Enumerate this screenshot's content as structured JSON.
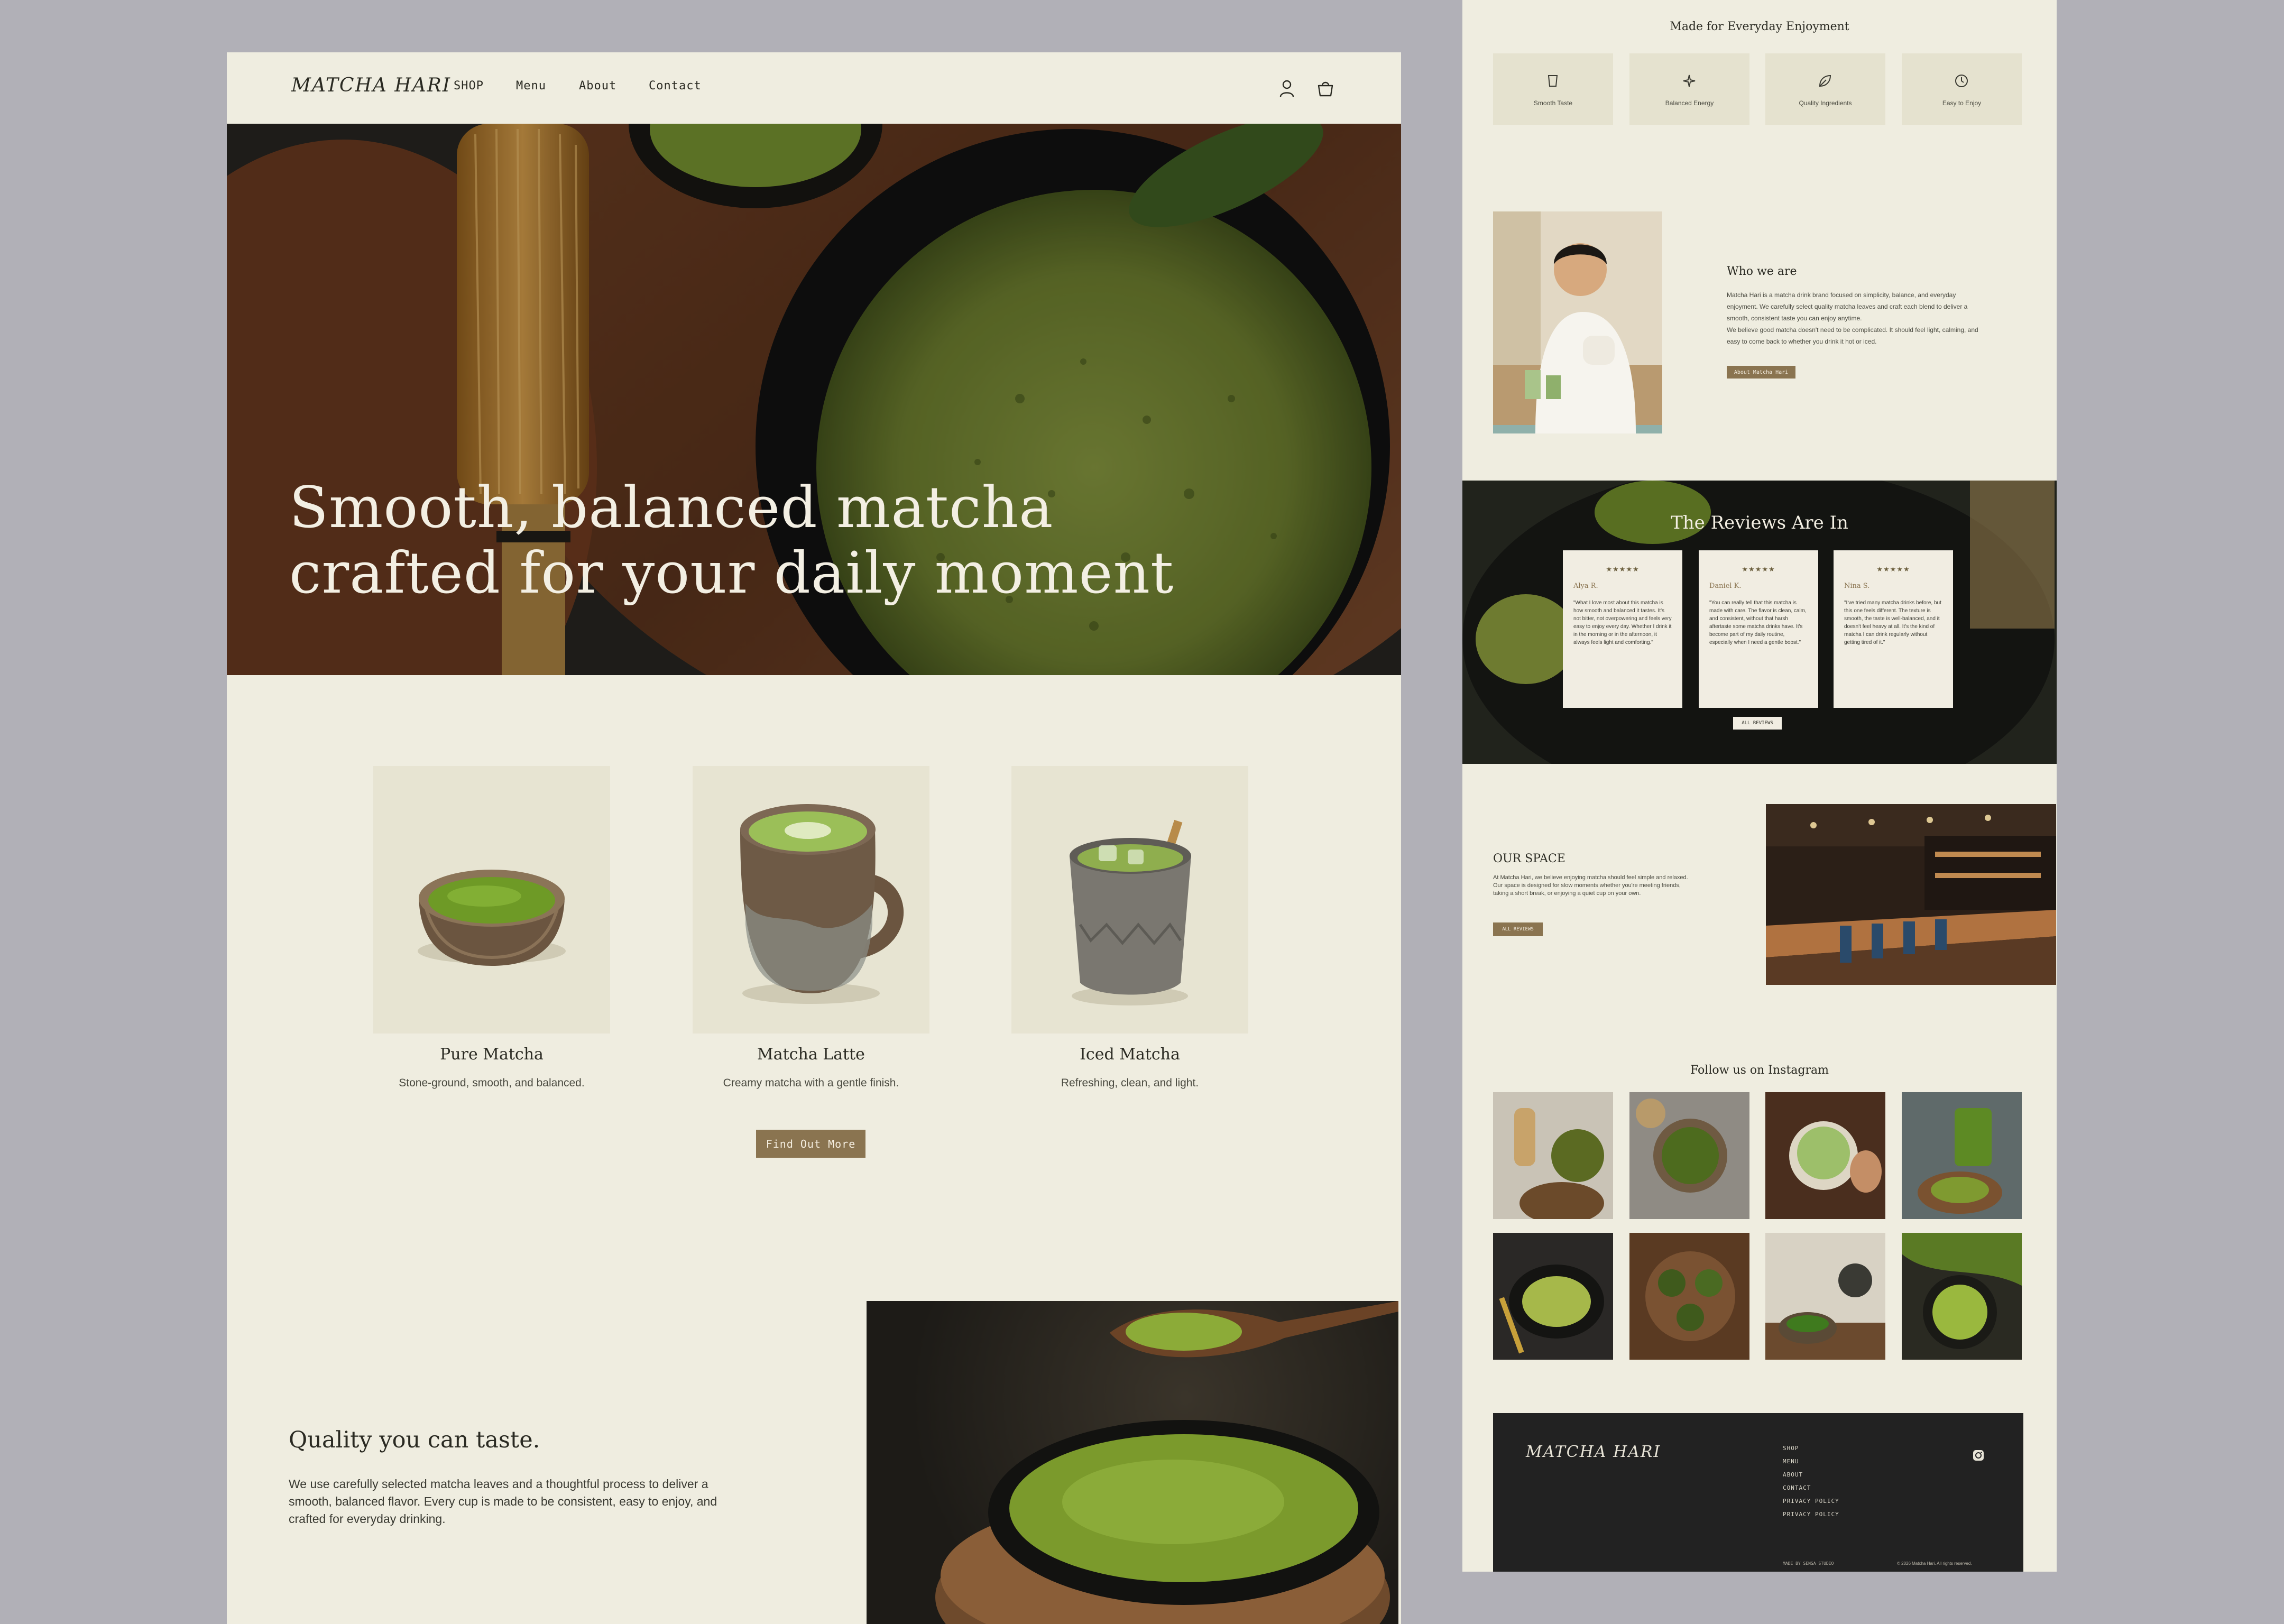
{
  "nav": {
    "logo": "MATCHA HARI",
    "links": [
      "SHOP",
      "Menu",
      "About",
      "Contact"
    ]
  },
  "hero": {
    "line1": "Smooth, balanced matcha",
    "line2": "crafted for your daily moment"
  },
  "products": [
    {
      "name": "Pure Matcha",
      "desc": "Stone-ground, smooth, and balanced."
    },
    {
      "name": "Matcha Latte",
      "desc": "Creamy matcha with a gentle finish."
    },
    {
      "name": "Iced Matcha",
      "desc": "Refreshing, clean, and light."
    }
  ],
  "find_out": "Find Out More",
  "quality": {
    "title": "Quality you can taste.",
    "body": "We use carefully selected matcha leaves and a thoughtful process to deliver a smooth, balanced flavor. Every cup is made to be consistent, easy to enjoy, and crafted for everyday drinking."
  },
  "features": {
    "title": "Made for Everyday Enjoyment",
    "items": [
      {
        "label": "Smooth Taste",
        "icon": "cup-icon"
      },
      {
        "label": "Balanced Energy",
        "icon": "sparkle-icon"
      },
      {
        "label": "Quality Ingredients",
        "icon": "leaf-icon"
      },
      {
        "label": "Easy to Enjoy",
        "icon": "clock-icon"
      }
    ]
  },
  "who": {
    "title": "Who we are",
    "body1": "Matcha Hari is a matcha drink brand focused on simplicity, balance, and everyday enjoyment. We carefully select quality matcha leaves and craft each blend to deliver a smooth, consistent taste you can enjoy anytime.",
    "body2": "We believe good matcha doesn't need to be complicated. It should feel light, calming, and easy to come back to whether you drink it hot or iced.",
    "button": "About Matcha Hari"
  },
  "reviews": {
    "title": "The Reviews Are In",
    "button": "ALL REVIEWS",
    "items": [
      {
        "stars": "★★★★★",
        "name": "Alya R.",
        "text": "\"What I love most about this matcha is how smooth and balanced it tastes. It's not bitter, not overpowering and feels very easy to enjoy every day. Whether I drink it in the morning or in the afternoon, it always feels light and comforting.\""
      },
      {
        "stars": "★★★★★",
        "name": "Daniel K.",
        "text": "\"You can really tell that this matcha is made with care. The flavor is clean, calm, and consistent, without that harsh aftertaste some matcha drinks have. It's become part of my daily routine, especially when I need a gentle boost.\""
      },
      {
        "stars": "★★★★★",
        "name": "Nina S.",
        "text": "\"I've tried many matcha drinks before, but this one feels different. The texture is smooth, the taste is well-balanced, and it doesn't feel heavy at all. It's the kind of matcha I can drink regularly without getting tired of it.\""
      }
    ]
  },
  "space": {
    "title": "OUR SPACE",
    "body": "At Matcha Hari, we believe enjoying matcha should feel simple and relaxed. Our space is designed for slow moments whether you're meeting friends, taking a short break, or enjoying a quiet cup on your own.",
    "button": "ALL REVIEWS"
  },
  "instagram": {
    "title": "Follow us on Instagram"
  },
  "footer": {
    "logo": "MATCHA HARI",
    "links": [
      "SHOP",
      "MENU",
      "ABOUT",
      "CONTACT",
      "PRIVACY POLICY",
      "PRIVACY POLICY"
    ],
    "made_by": "MADE BY SENSA STUDIO",
    "copyright": "© 2026 Matcha Hari. All rights reserved."
  },
  "colors": {
    "page_bg": "#b1b0b7",
    "cream": "#efede0",
    "accent": "#8a7450",
    "matcha": "#6f8a2e",
    "footer": "#222222"
  }
}
